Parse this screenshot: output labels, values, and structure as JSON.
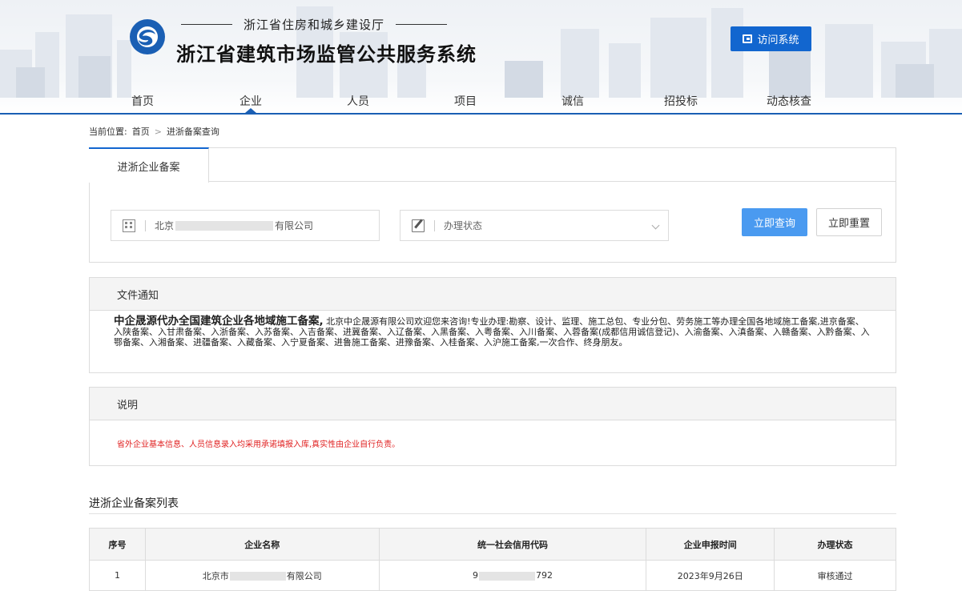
{
  "header": {
    "subtitle": "浙江省住房和城乡建设厅",
    "title": "浙江省建筑市场监管公共服务系统",
    "visit_button": "访问系统",
    "brand_color": "#1a5fb4"
  },
  "nav": {
    "items": [
      {
        "label": "首页"
      },
      {
        "label": "企业",
        "active": true
      },
      {
        "label": "人员"
      },
      {
        "label": "项目"
      },
      {
        "label": "诚信"
      },
      {
        "label": "招投标"
      },
      {
        "label": "动态核查"
      }
    ]
  },
  "breadcrumb": {
    "prefix": "当前位置:",
    "home": "首页",
    "separator": ">",
    "current": "进浙备案查询"
  },
  "search": {
    "tab": "进浙企业备案",
    "company_value_start": "北京",
    "company_value_end": "有限公司",
    "status_placeholder": "办理状态",
    "query_button": "立即查询",
    "reset_button": "立即重置",
    "query_color": "#4a9af0"
  },
  "notice": {
    "title": "文件通知",
    "lead": "中企晟源代办全国建筑企业各地域施工备案,",
    "text": "北京中企晟源有限公司欢迎您来咨询!专业办理:勘察、设计、监理、施工总包、专业分包、劳务施工等办理全国各地域施工备案,进京备案、入陕备案、入甘肃备案、入浙备案、入苏备案、入吉备案、进冀备案、入辽备案、入黑备案、入粤备案、入川备案、入蓉备案(成都信用诚信登记)、入渝备案、入滇备案、入赣备案、入黔备案、入鄂备案、入湘备案、进疆备案、入藏备案、入宁夏备案、进鲁施工备案、进豫备案、入桂备案、入沪施工备案,一次合作、终身朋友。"
  },
  "explain": {
    "title": "说明",
    "text": "省外企业基本信息、人员信息录入均采用承诺填报入库,真实性由企业自行负责。",
    "text_color": "#e02020"
  },
  "list": {
    "title": "进浙企业备案列表",
    "columns": [
      "序号",
      "企业名称",
      "统一社会信用代码",
      "企业申报时间",
      "办理状态"
    ],
    "rows": [
      {
        "index": "1",
        "name_start": "北京市",
        "name_end": "有限公司",
        "code_start": "9",
        "code_end": "792",
        "date": "2023年9月26日",
        "status": "审核通过"
      }
    ]
  }
}
